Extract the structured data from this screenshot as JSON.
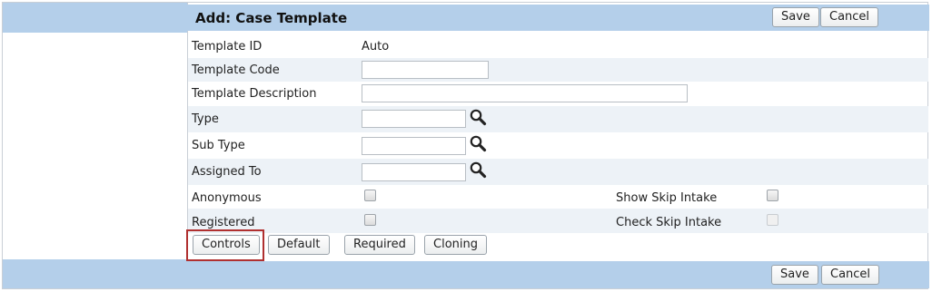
{
  "header": {
    "title": "Add: Case Template",
    "save_label": "Save",
    "cancel_label": "Cancel"
  },
  "form": {
    "template_id": {
      "label": "Template ID",
      "value": "Auto"
    },
    "template_code": {
      "label": "Template Code",
      "value": ""
    },
    "template_description": {
      "label": "Template Description",
      "value": ""
    },
    "type": {
      "label": "Type",
      "value": "",
      "icon": "magnifier-icon"
    },
    "sub_type": {
      "label": "Sub Type",
      "value": "",
      "icon": "magnifier-icon"
    },
    "assigned_to": {
      "label": "Assigned To",
      "value": "",
      "icon": "magnifier-icon"
    },
    "anonymous": {
      "label": "Anonymous",
      "checked": false
    },
    "show_skip_intake": {
      "label": "Show Skip Intake",
      "checked": false
    },
    "registered": {
      "label": "Registered",
      "checked": false
    },
    "check_skip_intake": {
      "label": "Check Skip Intake",
      "checked": false,
      "disabled": true
    }
  },
  "tab_buttons": {
    "controls": "Controls",
    "default": "Default",
    "required": "Required",
    "cloning": "Cloning"
  },
  "footer": {
    "save_label": "Save",
    "cancel_label": "Cancel"
  },
  "colors": {
    "header_band": "#b4cfea",
    "row_shade": "#edf2f7",
    "highlight_border": "#b03030"
  }
}
